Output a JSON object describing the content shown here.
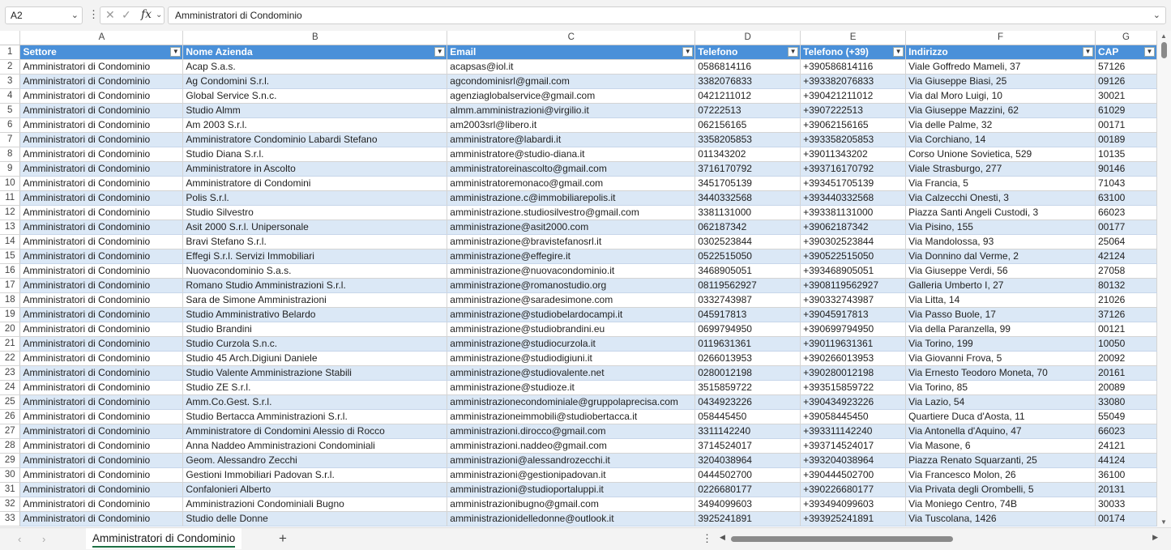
{
  "formula_bar": {
    "name_box": "A2",
    "more_icon": "vertical-ellipsis",
    "cancel_icon": "✕",
    "enter_icon": "✓",
    "fx_label": "fx",
    "formula": "Amministratori di Condominio"
  },
  "column_letters": [
    "A",
    "B",
    "C",
    "D",
    "E",
    "F",
    "G"
  ],
  "headers": [
    "Settore",
    "Nome Azienda",
    "Email",
    "Telefono",
    "Telefono (+39)",
    "Indirizzo",
    "CAP"
  ],
  "filter_icon": "▼",
  "rows": [
    [
      "2",
      "Amministratori di Condominio",
      "Acap S.a.s.",
      "acapsas@iol.it",
      "0586814116",
      "+390586814116",
      "Viale Goffredo Mameli, 37",
      "57126"
    ],
    [
      "3",
      "Amministratori di Condominio",
      "Ag Condomini S.r.l.",
      "agcondominisrl@gmail.com",
      "3382076833",
      "+393382076833",
      "Via Giuseppe Biasi, 25",
      "09126"
    ],
    [
      "4",
      "Amministratori di Condominio",
      "Global Service S.n.c.",
      "agenziaglobalservice@gmail.com",
      "0421211012",
      "+390421211012",
      "Via dal Moro Luigi, 10",
      "30021"
    ],
    [
      "5",
      "Amministratori di Condominio",
      "Studio Almm",
      "almm.amministrazioni@virgilio.it",
      "07222513",
      "+3907222513",
      "Via Giuseppe Mazzini, 62",
      "61029"
    ],
    [
      "6",
      "Amministratori di Condominio",
      "Am 2003 S.r.l.",
      "am2003srl@libero.it",
      "062156165",
      "+39062156165",
      "Via delle Palme, 32",
      "00171"
    ],
    [
      "7",
      "Amministratori di Condominio",
      "Amministratore Condominio Labardi Stefano",
      "amministratore@labardi.it",
      "3358205853",
      "+393358205853",
      "Via Corchiano, 14",
      "00189"
    ],
    [
      "8",
      "Amministratori di Condominio",
      "Studio Diana S.r.l.",
      "amministratore@studio-diana.it",
      "011343202",
      "+39011343202",
      "Corso Unione Sovietica, 529",
      "10135"
    ],
    [
      "9",
      "Amministratori di Condominio",
      "Amministratore in Ascolto",
      "amministratoreinascolto@gmail.com",
      "3716170792",
      "+393716170792",
      "Viale Strasburgo, 277",
      "90146"
    ],
    [
      "10",
      "Amministratori di Condominio",
      "Amministratore di Condomini",
      "amministratoremonaco@gmail.com",
      "3451705139",
      "+393451705139",
      "Via Francia, 5",
      "71043"
    ],
    [
      "11",
      "Amministratori di Condominio",
      "Polis S.r.l.",
      "amministrazione.c@immobiliarepolis.it",
      "3440332568",
      "+393440332568",
      "Via Calzecchi Onesti, 3",
      "63100"
    ],
    [
      "12",
      "Amministratori di Condominio",
      "Studio Silvestro",
      "amministrazione.studiosilvestro@gmail.com",
      "3381131000",
      "+393381131000",
      "Piazza Santi Angeli Custodi, 3",
      "66023"
    ],
    [
      "13",
      "Amministratori di Condominio",
      "Asit 2000 S.r.l. Unipersonale",
      "amministrazione@asit2000.com",
      "062187342",
      "+39062187342",
      "Via Pisino, 155",
      "00177"
    ],
    [
      "14",
      "Amministratori di Condominio",
      "Bravi Stefano S.r.l.",
      "amministrazione@bravistefanosrl.it",
      "0302523844",
      "+390302523844",
      "Via Mandolossa, 93",
      "25064"
    ],
    [
      "15",
      "Amministratori di Condominio",
      "Effegi S.r.l. Servizi Immobiliari",
      "amministrazione@effegire.it",
      "0522515050",
      "+390522515050",
      "Via Donnino dal Verme, 2",
      "42124"
    ],
    [
      "16",
      "Amministratori di Condominio",
      "Nuovacondominio S.a.s.",
      "amministrazione@nuovacondominio.it",
      "3468905051",
      "+393468905051",
      "Via Giuseppe Verdi, 56",
      "27058"
    ],
    [
      "17",
      "Amministratori di Condominio",
      "Romano Studio Amministrazioni S.r.l.",
      "amministrazione@romanostudio.org",
      "08119562927",
      "+3908119562927",
      "Galleria Umberto I, 27",
      "80132"
    ],
    [
      "18",
      "Amministratori di Condominio",
      "Sara de Simone Amministrazioni",
      "amministrazione@saradesimone.com",
      "0332743987",
      "+390332743987",
      "Via Litta, 14",
      "21026"
    ],
    [
      "19",
      "Amministratori di Condominio",
      "Studio Amministrativo Belardo",
      "amministrazione@studiobelardocampi.it",
      "045917813",
      "+39045917813",
      "Via Passo Buole, 17",
      "37126"
    ],
    [
      "20",
      "Amministratori di Condominio",
      "Studio Brandini",
      "amministrazione@studiobrandini.eu",
      "0699794950",
      "+390699794950",
      "Via della Paranzella, 99",
      "00121"
    ],
    [
      "21",
      "Amministratori di Condominio",
      "Studio Curzola S.n.c.",
      "amministrazione@studiocurzola.it",
      "0119631361",
      "+390119631361",
      "Via Torino, 199",
      "10050"
    ],
    [
      "22",
      "Amministratori di Condominio",
      "Studio 45 Arch.Digiuni Daniele",
      "amministrazione@studiodigiuni.it",
      "0266013953",
      "+390266013953",
      "Via Giovanni Frova, 5",
      "20092"
    ],
    [
      "23",
      "Amministratori di Condominio",
      "Studio Valente Amministrazione Stabili",
      "amministrazione@studiovalente.net",
      "0280012198",
      "+390280012198",
      "Via Ernesto Teodoro Moneta, 70",
      "20161"
    ],
    [
      "24",
      "Amministratori di Condominio",
      "Studio ZE S.r.l.",
      "amministrazione@studioze.it",
      "3515859722",
      "+393515859722",
      "Via Torino, 85",
      "20089"
    ],
    [
      "25",
      "Amministratori di Condominio",
      "Amm.Co.Gest. S.r.l.",
      "amministrazionecondominiale@gruppolaprecisa.com",
      "0434923226",
      "+390434923226",
      "Via Lazio, 54",
      "33080"
    ],
    [
      "26",
      "Amministratori di Condominio",
      "Studio Bertacca Amministrazioni S.r.l.",
      "amministrazioneimmobili@studiobertacca.it",
      "058445450",
      "+39058445450",
      "Quartiere Duca d'Aosta, 11",
      "55049"
    ],
    [
      "27",
      "Amministratori di Condominio",
      "Amministratore di Condomini Alessio di Rocco",
      "amministrazioni.dirocco@gmail.com",
      "3311142240",
      "+393311142240",
      "Via Antonella d'Aquino, 47",
      "66023"
    ],
    [
      "28",
      "Amministratori di Condominio",
      "Anna Naddeo Amministrazioni Condominiali",
      "amministrazioni.naddeo@gmail.com",
      "3714524017",
      "+393714524017",
      "Via Masone, 6",
      "24121"
    ],
    [
      "29",
      "Amministratori di Condominio",
      "Geom. Alessandro Zecchi",
      "amministrazioni@alessandrozecchi.it",
      "3204038964",
      "+393204038964",
      "Piazza Renato Squarzanti, 25",
      "44124"
    ],
    [
      "30",
      "Amministratori di Condominio",
      "Gestioni Immobiliari Padovan S.r.l.",
      "amministrazioni@gestionipadovan.it",
      "0444502700",
      "+390444502700",
      "Via Francesco Molon, 26",
      "36100"
    ],
    [
      "31",
      "Amministratori di Condominio",
      "Confalonieri Alberto",
      "amministrazioni@studioportaluppi.it",
      "0226680177",
      "+390226680177",
      "Via Privata degli Orombelli, 5",
      "20131"
    ],
    [
      "32",
      "Amministratori di Condominio",
      "Amministrazioni Condominiali Bugno",
      "amministrazionibugno@gmail.com",
      "3494099603",
      "+393494099603",
      "Via Moniego Centro, 74B",
      "30033"
    ],
    [
      "33",
      "Amministratori di Condominio",
      "Studio delle Donne",
      "amministrazionidelledonne@outlook.it",
      "3925241891",
      "+393925241891",
      "Via Tuscolana, 1426",
      "00174"
    ]
  ],
  "sheet_tab": "Amministratori di Condominio",
  "add_sheet": "+",
  "header_row_number": "1"
}
